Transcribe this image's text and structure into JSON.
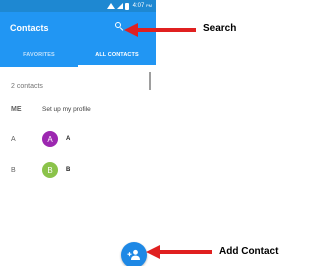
{
  "status_bar": {
    "time": "4:07",
    "ampm": "PM"
  },
  "app_bar": {
    "title": "Contacts",
    "search_icon": "search-icon"
  },
  "tabs": [
    {
      "label": "FAVORITES",
      "active": false
    },
    {
      "label": "ALL CONTACTS",
      "active": true
    }
  ],
  "contact_count": "2 contacts",
  "profile": {
    "letter": "ME",
    "text": "Set up my profile"
  },
  "contacts": [
    {
      "section": "A",
      "initial": "A",
      "name": "A",
      "color": "#9c27b0"
    },
    {
      "section": "B",
      "initial": "B",
      "name": "B",
      "color": "#8bc34a"
    }
  ],
  "fab": {
    "icon": "add-person-icon"
  },
  "annotations": {
    "search_label": "Search",
    "add_contact_label": "Add Contact",
    "arrow_color": "#e02020"
  }
}
